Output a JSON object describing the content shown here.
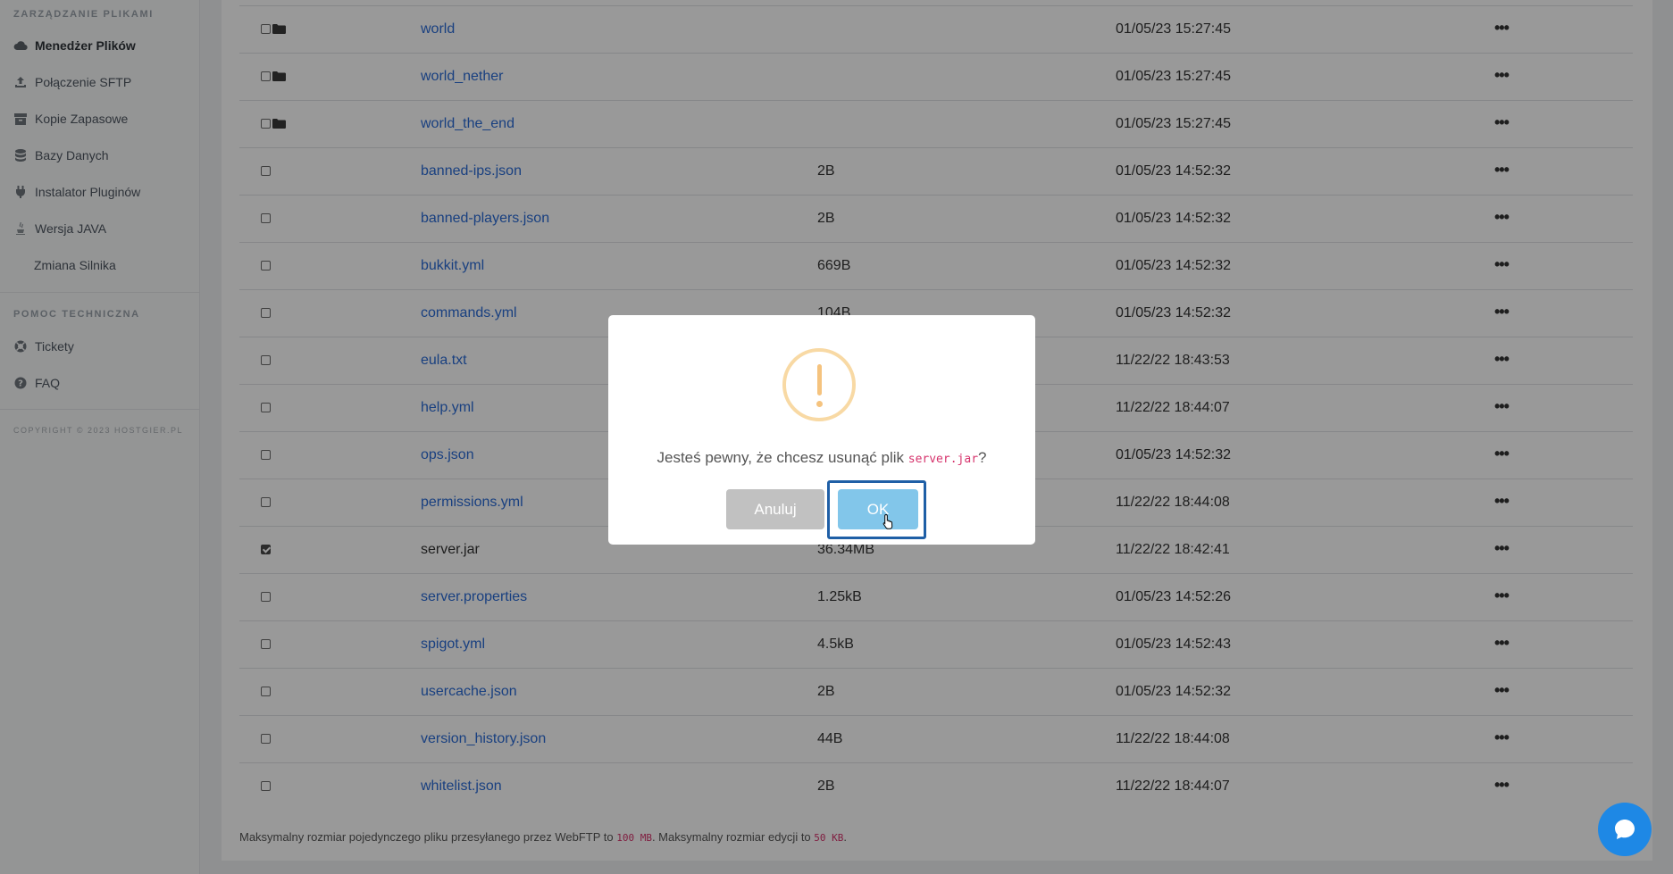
{
  "sidebar": {
    "section_files": "Zarządzanie plikami",
    "items": [
      {
        "label": "Menedżer Plików",
        "icon": "cloud-icon"
      },
      {
        "label": "Połączenie SFTP",
        "icon": "upload-icon"
      },
      {
        "label": "Kopie Zapasowe",
        "icon": "archive-icon"
      },
      {
        "label": "Bazy Danych",
        "icon": "database-icon"
      },
      {
        "label": "Instalator Pluginów",
        "icon": "plug-icon"
      },
      {
        "label": "Wersja JAVA",
        "icon": "java-icon"
      },
      {
        "label": "Zmiana Silnika",
        "icon": ""
      }
    ],
    "section_support": "Pomoc techniczna",
    "support_items": [
      {
        "label": "Tickety",
        "icon": "lifebuoy-icon"
      },
      {
        "label": "FAQ",
        "icon": "question-icon"
      }
    ],
    "copyright": "Copyright © 2023 hostgier.pl"
  },
  "files": [
    {
      "name": "world",
      "size": "",
      "date": "01/05/23 15:27:45",
      "folder": true,
      "checked": false
    },
    {
      "name": "world_nether",
      "size": "",
      "date": "01/05/23 15:27:45",
      "folder": true,
      "checked": false
    },
    {
      "name": "world_the_end",
      "size": "",
      "date": "01/05/23 15:27:45",
      "folder": true,
      "checked": false
    },
    {
      "name": "banned-ips.json",
      "size": "2B",
      "date": "01/05/23 14:52:32",
      "folder": false,
      "checked": false
    },
    {
      "name": "banned-players.json",
      "size": "2B",
      "date": "01/05/23 14:52:32",
      "folder": false,
      "checked": false
    },
    {
      "name": "bukkit.yml",
      "size": "669B",
      "date": "01/05/23 14:52:32",
      "folder": false,
      "checked": false
    },
    {
      "name": "commands.yml",
      "size": "104B",
      "date": "01/05/23 14:52:32",
      "folder": false,
      "checked": false
    },
    {
      "name": "eula.txt",
      "size": "",
      "date": "11/22/22 18:43:53",
      "folder": false,
      "checked": false
    },
    {
      "name": "help.yml",
      "size": "",
      "date": "11/22/22 18:44:07",
      "folder": false,
      "checked": false
    },
    {
      "name": "ops.json",
      "size": "",
      "date": "01/05/23 14:52:32",
      "folder": false,
      "checked": false
    },
    {
      "name": "permissions.yml",
      "size": "",
      "date": "11/22/22 18:44:08",
      "folder": false,
      "checked": false
    },
    {
      "name": "server.jar",
      "size": "36.34MB",
      "date": "11/22/22 18:42:41",
      "folder": false,
      "checked": true
    },
    {
      "name": "server.properties",
      "size": "1.25kB",
      "date": "01/05/23 14:52:26",
      "folder": false,
      "checked": false
    },
    {
      "name": "spigot.yml",
      "size": "4.5kB",
      "date": "01/05/23 14:52:43",
      "folder": false,
      "checked": false
    },
    {
      "name": "usercache.json",
      "size": "2B",
      "date": "01/05/23 14:52:32",
      "folder": false,
      "checked": false
    },
    {
      "name": "version_history.json",
      "size": "44B",
      "date": "11/22/22 18:44:08",
      "folder": false,
      "checked": false
    },
    {
      "name": "whitelist.json",
      "size": "2B",
      "date": "11/22/22 18:44:07",
      "folder": false,
      "checked": false
    }
  ],
  "row_menu": "•••",
  "footnote": {
    "part1": "Maksymalny rozmiar pojedynczego pliku przesyłanego przez WebFTP to ",
    "limit1": "100 MB",
    "part2": ". Maksymalny rozmiar edycji to ",
    "limit2": "50 KB",
    "part3": "."
  },
  "modal": {
    "message_before": "Jesteś pewny, że chcesz usunąć plik ",
    "filename": "server.jar",
    "message_after": "?",
    "cancel_label": "Anuluj",
    "ok_label": "OK"
  },
  "colors": {
    "link": "#2b6bd6",
    "warning": "#f8bb86",
    "ok_button": "#82c6ea",
    "cancel_button": "#c1c1c1",
    "chat": "#1e88e5"
  }
}
